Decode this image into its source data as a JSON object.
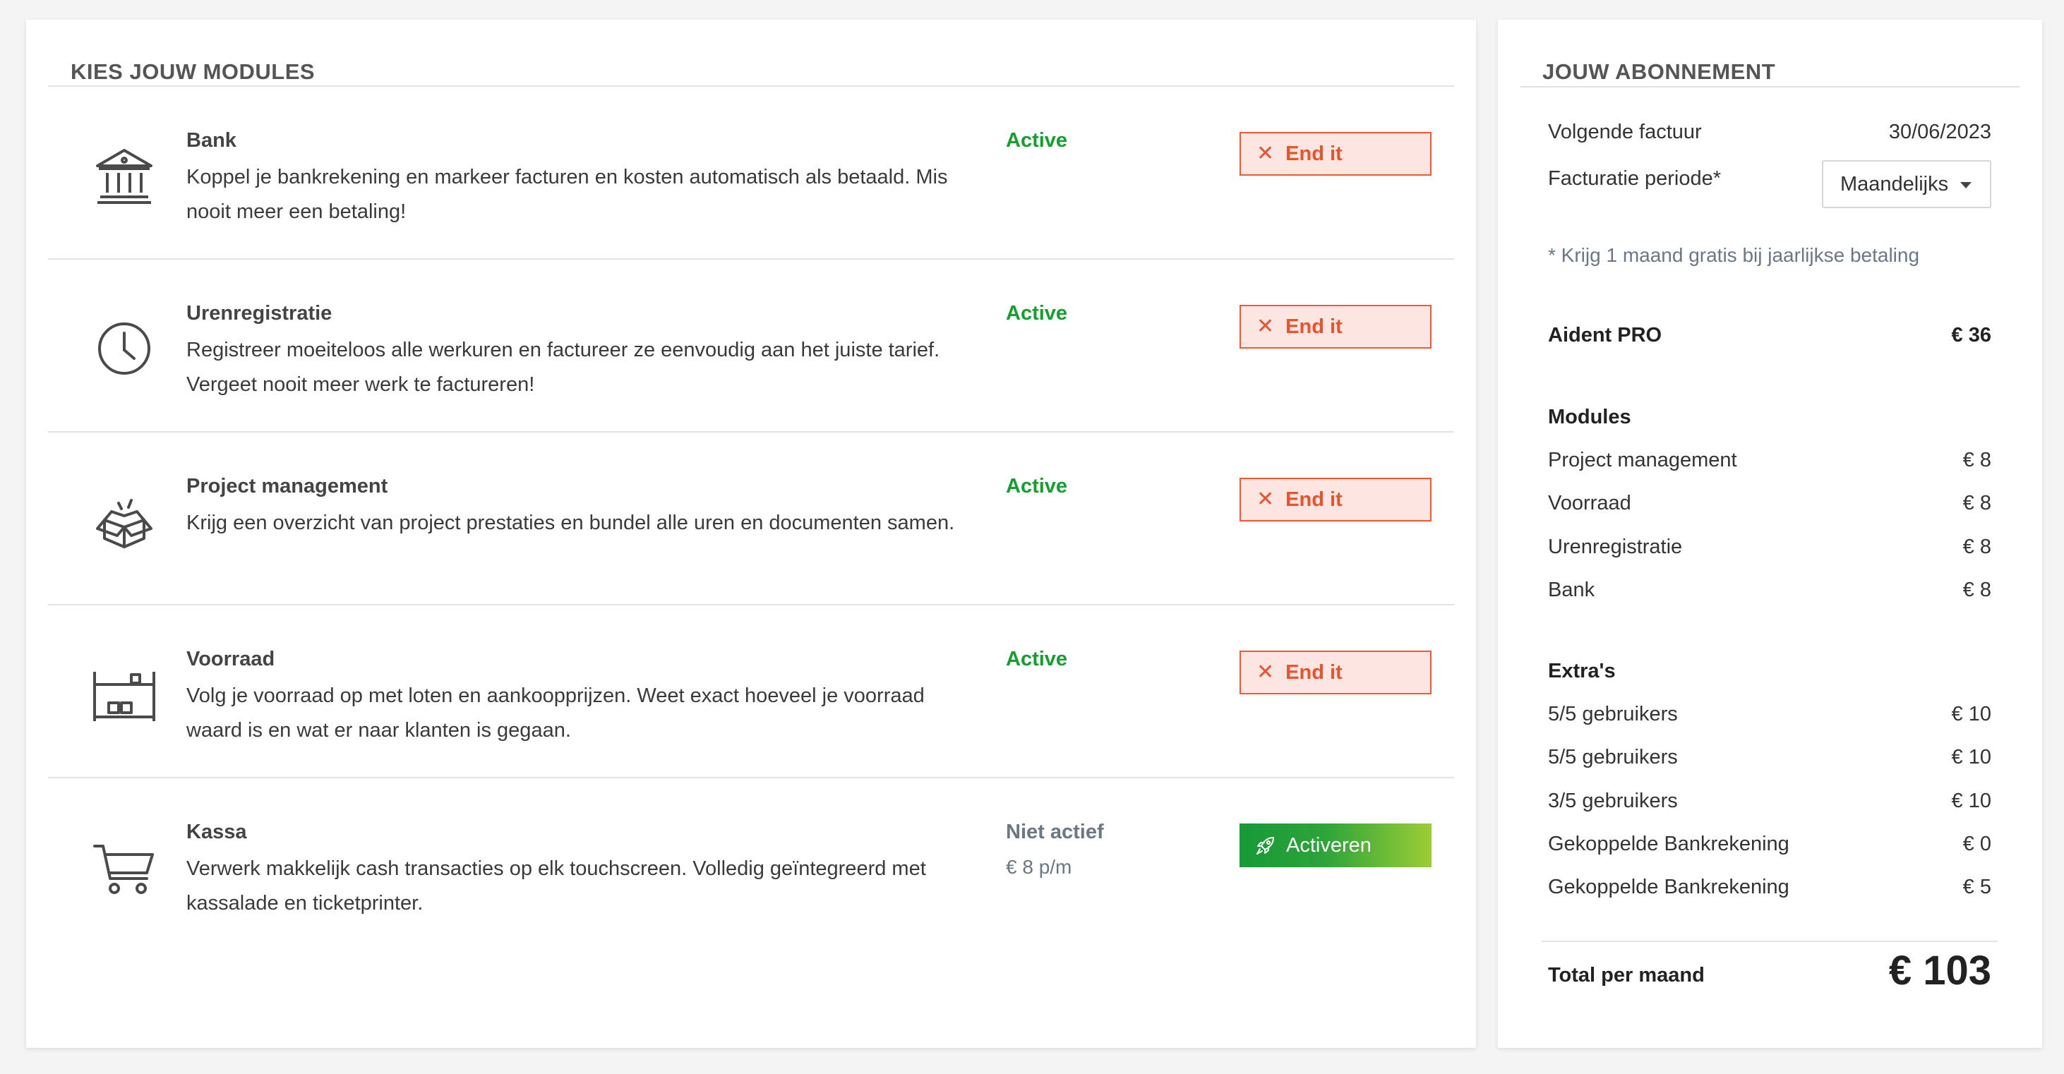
{
  "modules_panel": {
    "title": "KIES JOUW MODULES",
    "modules": [
      {
        "name": "Bank",
        "icon": "bank-icon",
        "description": "Koppel je bankrekening en markeer facturen en kosten automatisch als betaald. Mis nooit meer een betaling!",
        "status": "Active",
        "button": "End it"
      },
      {
        "name": "Urenregistratie",
        "icon": "clock-icon",
        "description": "Registreer moeiteloos alle werkuren en factureer ze eenvoudig aan het juiste tarief. Vergeet nooit meer werk te factureren!",
        "status": "Active",
        "button": "End it"
      },
      {
        "name": "Project management",
        "icon": "open-box-icon",
        "description": "Krijg een overzicht van project prestaties en bundel alle uren en documenten samen.",
        "status": "Active",
        "button": "End it"
      },
      {
        "name": "Voorraad",
        "icon": "warehouse-shelf-icon",
        "description": "Volg je voorraad op met loten en aankoopprijzen. Weet exact hoeveel je voorraad waard is en wat er naar klanten is gegaan.",
        "status": "Active",
        "button": "End it"
      },
      {
        "name": "Kassa",
        "icon": "shopping-cart-icon",
        "description": "Verwerk makkelijk cash transacties op elk touchscreen. Volledig geïntegreerd met kassalade en ticketprinter.",
        "status": "Niet actief",
        "price": "€ 8 p/m",
        "button": "Activeren"
      }
    ]
  },
  "subscription": {
    "title": "JOUW ABONNEMENT",
    "next_invoice_label": "Volgende factuur",
    "next_invoice_date": "30/06/2023",
    "billing_period_label": "Facturatie periode*",
    "billing_period_value": "Maandelijks",
    "note": "* Krijg 1 maand gratis bij jaarlijkse betaling",
    "plan": {
      "name": "Aident PRO",
      "price": "€ 36"
    },
    "modules_heading": "Modules",
    "modules": [
      {
        "name": "Project management",
        "price": "€ 8"
      },
      {
        "name": "Voorraad",
        "price": "€ 8"
      },
      {
        "name": "Urenregistratie",
        "price": "€ 8"
      },
      {
        "name": "Bank",
        "price": "€ 8"
      }
    ],
    "extras_heading": "Extra's",
    "extras": [
      {
        "name": "5/5 gebruikers",
        "price": "€ 10"
      },
      {
        "name": "5/5 gebruikers",
        "price": "€ 10"
      },
      {
        "name": "3/5 gebruikers",
        "price": "€ 10"
      },
      {
        "name": "Gekoppelde Bankrekening",
        "price": "€ 0"
      },
      {
        "name": "Gekoppelde Bankrekening",
        "price": "€ 5"
      }
    ],
    "total_label": "Total per maand",
    "total_value": "€ 103"
  },
  "colors": {
    "active_green": "#14a02c",
    "end_it_red": "#e8532d",
    "end_it_bg": "#fde6e1",
    "inactive_gray": "#6b7785",
    "activate_gradient_start": "#169a37",
    "activate_gradient_end": "#9ccd36"
  }
}
